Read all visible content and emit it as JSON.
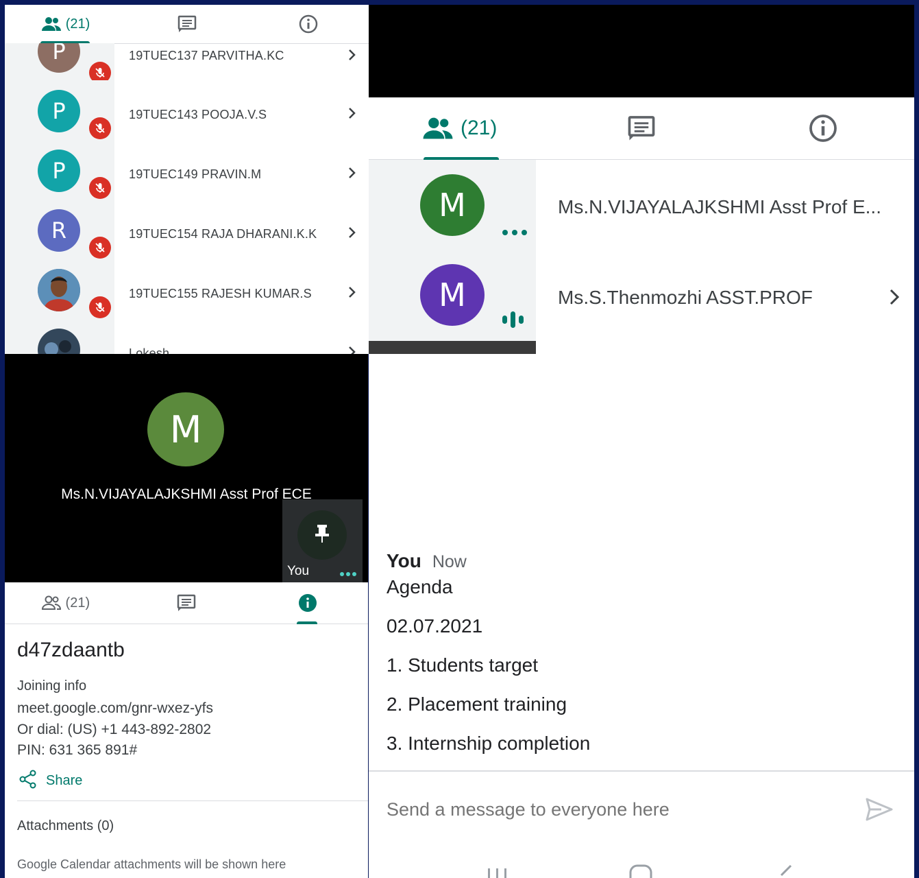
{
  "participants_panel": {
    "tabs": [
      {
        "label": "(21)",
        "icon": "people-icon",
        "active": true
      },
      {
        "label": "",
        "icon": "chat-icon",
        "active": false
      },
      {
        "label": "",
        "icon": "info-icon",
        "active": false
      }
    ],
    "rows": [
      {
        "name": "19TUEC137 PARVITHA.KC",
        "initial": "P",
        "color": "#8d6e63",
        "muted": true
      },
      {
        "name": "19TUEC143 POOJA.V.S",
        "initial": "P",
        "color": "#12a4a8",
        "muted": true
      },
      {
        "name": "19TUEC149 PRAVIN.M",
        "initial": "P",
        "color": "#12a4a8",
        "muted": true
      },
      {
        "name": "19TUEC154 RAJA DHARANI.K.K",
        "initial": "R",
        "color": "#5c6bc0",
        "muted": true
      },
      {
        "name": "19TUEC155 RAJESH KUMAR.S",
        "initial": "",
        "color": "#4a7fa8",
        "muted": true
      },
      {
        "name": "Lokesh",
        "initial": "",
        "color": "#33475b",
        "muted": false
      }
    ]
  },
  "video_tile": {
    "initial": "M",
    "avatar_color": "#5b8a3c",
    "name": "Ms.N.VIJAYALAJKSHMI Asst Prof ECE",
    "self_label": "You"
  },
  "info_panel": {
    "tabs": [
      {
        "label": "(21)",
        "icon": "people-icon",
        "active": false
      },
      {
        "label": "",
        "icon": "chat-icon",
        "active": false
      },
      {
        "label": "",
        "icon": "info-icon",
        "active": true
      }
    ],
    "meeting_code": "d47zdaantb",
    "joining_info_label": "Joining info",
    "meet_link": "meet.google.com/gnr-wxez-yfs",
    "dial": "Or dial: (US) +1 443-892-2802",
    "pin": "PIN: 631 365 891#",
    "share_label": "Share",
    "attachments_label": "Attachments (0)",
    "attachments_note": "Google Calendar attachments will be shown here"
  },
  "right_panel": {
    "tabs": [
      {
        "label": "(21)",
        "icon": "people-icon",
        "active": true
      },
      {
        "label": "",
        "icon": "chat-icon",
        "active": false
      },
      {
        "label": "",
        "icon": "info-icon",
        "active": false
      }
    ],
    "participants": [
      {
        "name": "Ms.N.VIJAYALAJKSHMI Asst Prof E...",
        "initial": "M",
        "color": "#2e7d32",
        "indicator": "more-dots-icon"
      },
      {
        "name": "Ms.S.Thenmozhi ASST.PROF",
        "initial": "M",
        "color": "#5e35b1",
        "indicator": "speaking-bars-icon"
      }
    ],
    "message": {
      "sender": "You",
      "time": "Now",
      "lines": [
        "Agenda",
        "02.07.2021",
        "1. Students target",
        "2. Placement training",
        "3. Internship completion"
      ]
    },
    "composer_placeholder": "Send a message to everyone here"
  },
  "colors": {
    "accent": "#00796b",
    "mute": "#d93025",
    "frame": "#0a1a5c"
  }
}
